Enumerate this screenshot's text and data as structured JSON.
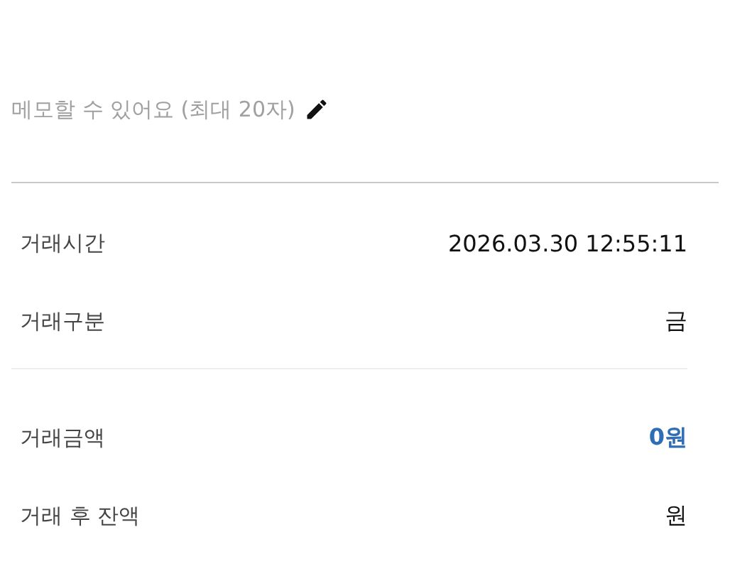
{
  "memo": {
    "placeholder": "메모할 수 있어요 (최대 20자)"
  },
  "sections": [
    {
      "rows": [
        {
          "label": "거래시간",
          "value": "2026.03.30 12:55:11",
          "kind": "plain"
        },
        {
          "label": "거래구분",
          "value": "금",
          "kind": "plain"
        }
      ]
    },
    {
      "rows": [
        {
          "label": "거래금액",
          "value": "0원",
          "kind": "amount"
        },
        {
          "label": "거래 후 잔액",
          "value": "원",
          "kind": "plain"
        }
      ]
    }
  ]
}
